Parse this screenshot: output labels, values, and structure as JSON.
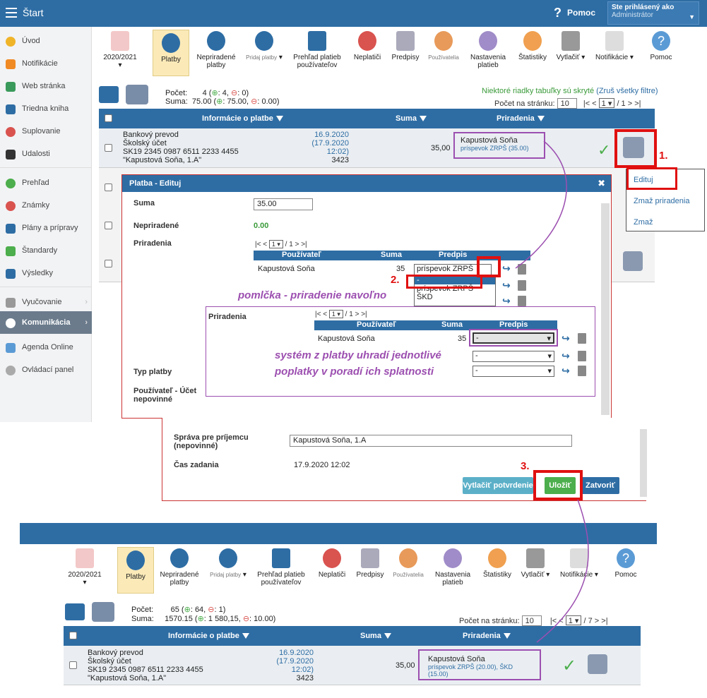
{
  "topbar": {
    "title": "Štart",
    "help": "Pomoc",
    "login_line1": "Ste prihlásený ako",
    "login_line2": "Administrátor"
  },
  "sidebar": {
    "items": [
      {
        "label": "Úvod"
      },
      {
        "label": "Notifikácie"
      },
      {
        "label": "Web stránka"
      },
      {
        "label": "Triedna kniha"
      },
      {
        "label": "Suplovanie"
      },
      {
        "label": "Udalosti"
      },
      {
        "label": "Prehľad"
      },
      {
        "label": "Známky"
      },
      {
        "label": "Plány a prípravy"
      },
      {
        "label": "Štandardy"
      },
      {
        "label": "Výsledky"
      },
      {
        "label": "Vyučovanie"
      },
      {
        "label": "Komunikácia"
      },
      {
        "label": "Agenda Online"
      },
      {
        "label": "Ovládací panel"
      }
    ]
  },
  "toolbar": {
    "items": [
      {
        "label": "2020/2021"
      },
      {
        "label": "Platby"
      },
      {
        "label": "Nepriradené platby"
      },
      {
        "label": "Pridaj platby"
      },
      {
        "label": "Prehľad platieb používateľov"
      },
      {
        "label": "Neplatiči"
      },
      {
        "label": "Predpisy"
      },
      {
        "label": "Používatelia"
      },
      {
        "label": "Nastavenia platieb"
      },
      {
        "label": "Štatistiky"
      },
      {
        "label": "Vytlačiť"
      },
      {
        "label": "Notifikácie"
      },
      {
        "label": "Pomoc"
      }
    ]
  },
  "summary1": {
    "count_label": "Počet:",
    "count_value": "4 (",
    "count_plus": ": 4, ",
    "count_minus": ": 0)",
    "sum_label": "Suma:",
    "sum_value": "75.00 (",
    "sum_plus": ": 75.00, ",
    "sum_minus": ": 0.00)",
    "hidden_note": "Niektoré riadky tabuľky sú skryté",
    "show_filters": "(Zruš všetky filtre)",
    "per_page_label": "Počet na stránku:",
    "per_page_value": "10",
    "page_select": "1",
    "page_total": "/ 1",
    "nav_prev": "|< <",
    "nav_next": "> >|"
  },
  "table1": {
    "headers": {
      "info": "Informácie o platbe",
      "sum": "Suma",
      "assign": "Priradenia"
    },
    "row": {
      "type": "Bankový prevod",
      "account_name": "Školský účet",
      "iban": "SK19 2345 0987 6511 2233 4455",
      "note": "\"Kapustová Soňa, 1.A\"",
      "date": "16.9.2020",
      "date2": "(17.9.2020 12:02)",
      "vs": "3423",
      "amount": "35,00",
      "assign_name": "Kapustová Soňa",
      "assign_detail": "príspevok ZRPŠ (35.00)"
    }
  },
  "context_menu": {
    "edit": "Edituj",
    "delete_assign": "Zmaž priradenia",
    "delete": "Zmaž"
  },
  "steps": {
    "s1": "1.",
    "s2": "2.",
    "s3": "3."
  },
  "dialog": {
    "title": "Platba - Edituj",
    "sum_label": "Suma",
    "sum_value": "35.00",
    "unassigned_label": "Nepriradené",
    "unassigned_value": "0.00",
    "assign_label": "Priradenia",
    "pager": {
      "first": "|< <",
      "page": "1",
      "total": "/ 1",
      "last": "> >|"
    },
    "cols": {
      "user": "Používateľ",
      "sum": "Suma",
      "rule": "Predpis"
    },
    "row": {
      "user": "Kapustová Soňa",
      "sum": "35",
      "rule": "príspevok ZRPŠ"
    },
    "dropdown_options": [
      "-",
      "príspevok ZRPŠ",
      "ŠKD"
    ],
    "type_label": "Typ platby",
    "user_account_label": "Používateľ - Účet nepovinné",
    "message_label": "Správa pre príjemcu (nepovinné)",
    "message_value": "Kapustová Soňa, 1.A",
    "time_label": "Čas zadania",
    "time_value": "17.9.2020 12:02",
    "btn_print": "Vytlačiť potvrdenie",
    "btn_save": "Uložiť",
    "btn_close": "Zatvoriť"
  },
  "notes": {
    "dash": "pomlčka - priradenie navoľno",
    "system_line1": "systém z platby uhradí jednotlivé",
    "system_line2": "poplatky v poradí ich splatnosti"
  },
  "inner": {
    "assign_label": "Priradenia",
    "pager": {
      "first": "|< <",
      "page": "1",
      "total": "/ 1",
      "last": "> >|"
    },
    "cols": {
      "user": "Používateľ",
      "sum": "Suma",
      "rule": "Predpis"
    },
    "row": {
      "user": "Kapustová Soňa",
      "sum": "35",
      "rule": "-"
    },
    "rule2": "-",
    "rule3": "-"
  },
  "summary2": {
    "count_label": "Počet:",
    "count_value": "65 (",
    "count_plus": ": 64, ",
    "count_minus": ": 1)",
    "sum_label": "Suma:",
    "sum_value": "1570.15 (",
    "sum_plus": ": 1 580,15, ",
    "sum_minus": ": 10.00)",
    "per_page_label": "Počet na stránku:",
    "per_page_value": "10",
    "page_select": "1",
    "page_total": "/ 7",
    "nav_prev": "|< <",
    "nav_next": "> >|"
  },
  "table2": {
    "headers": {
      "info": "Informácie o platbe",
      "sum": "Suma",
      "assign": "Priradenia"
    },
    "row": {
      "type": "Bankový prevod",
      "account_name": "Školský účet",
      "iban": "SK19 2345 0987 6511 2233 4455",
      "note": "\"Kapustová Soňa, 1.A\"",
      "date": "16.9.2020",
      "date2": "(17.9.2020 12:02)",
      "vs": "3423",
      "amount": "35,00",
      "assign_name": "Kapustová Soňa",
      "assign_detail": "príspevok ZRPŠ (20.00), ŠKD (15.00)"
    }
  },
  "colors": {
    "primary": "#2e6da4",
    "annotation_red": "#e01010",
    "annotation_purple": "#9c4fb0",
    "save_green": "#4cae4c",
    "print_teal": "#5bb0c8"
  }
}
